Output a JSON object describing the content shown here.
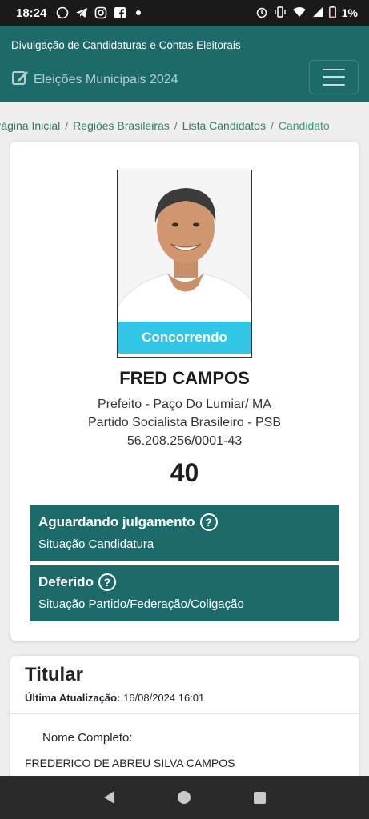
{
  "status_bar": {
    "time": "18:24",
    "battery": "1%"
  },
  "header": {
    "subtitle": "Divulgação de Candidaturas e Contas Eleitorais",
    "brand": "Eleições Municipais 2024"
  },
  "breadcrumb": {
    "items": [
      "Página Inicial",
      "Regiões Brasileiras",
      "Lista Candidatos"
    ],
    "current": "Candidato"
  },
  "candidate": {
    "status_pill": "Concorrendo",
    "name": "FRED CAMPOS",
    "office": "Prefeito - Paço Do Lumiar/ MA",
    "party": "Partido Socialista Brasileiro - PSB",
    "cnpj": "56.208.256/0001-43",
    "number": "40"
  },
  "status_boxes": [
    {
      "title": "Aguardando julgamento",
      "desc": "Situação Candidatura"
    },
    {
      "title": "Deferido",
      "desc": "Situação Partido/Federação/Coligação"
    }
  ],
  "titular": {
    "heading": "Titular",
    "updated_label": "Última Atualização:",
    "updated_value": "16/08/2024 16:01",
    "field_label": "Nome Completo:",
    "field_value": "FREDERICO DE ABREU SILVA CAMPOS"
  },
  "colors": {
    "primary": "#1d6a6a",
    "accent": "#31c6e5",
    "link": "#2e7d5a"
  }
}
